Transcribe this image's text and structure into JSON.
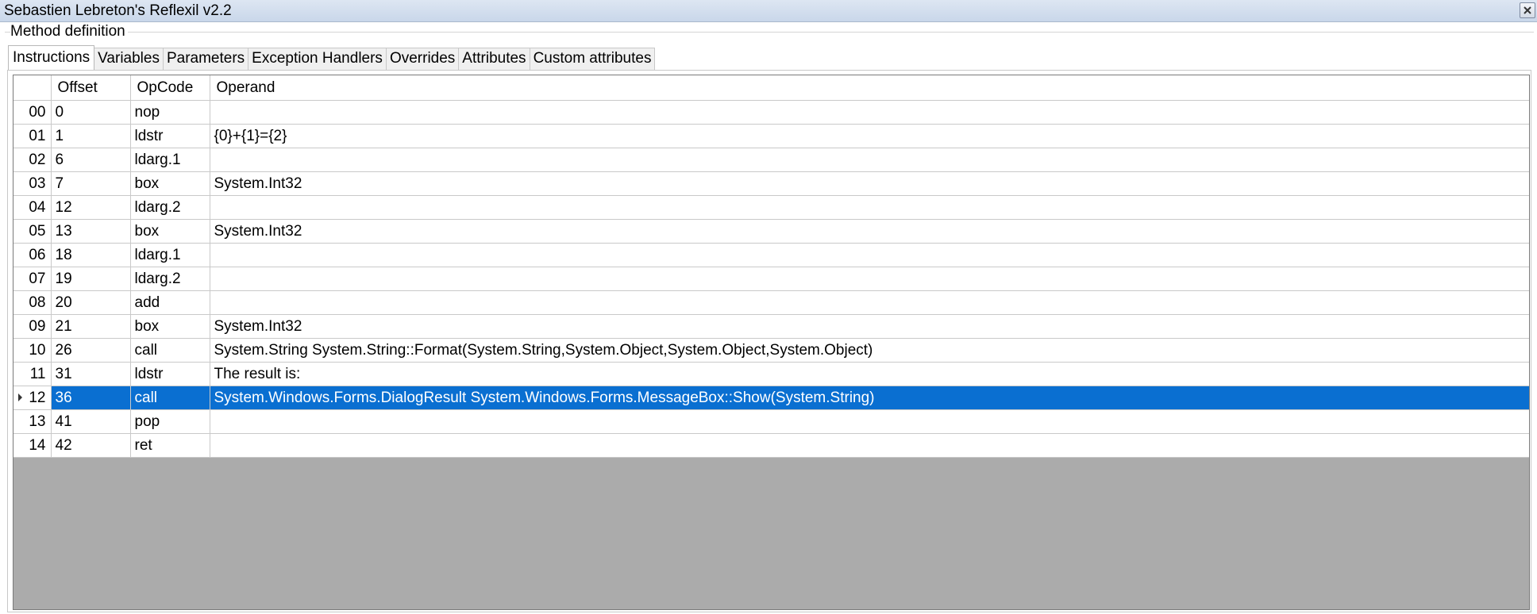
{
  "window": {
    "title": "Sebastien Lebreton's Reflexil v2.2"
  },
  "group": {
    "label": "Method definition"
  },
  "tabs": [
    {
      "label": "Instructions",
      "active": true
    },
    {
      "label": "Variables",
      "active": false
    },
    {
      "label": "Parameters",
      "active": false
    },
    {
      "label": "Exception Handlers",
      "active": false
    },
    {
      "label": "Overrides",
      "active": false
    },
    {
      "label": "Attributes",
      "active": false
    },
    {
      "label": "Custom attributes",
      "active": false
    }
  ],
  "grid": {
    "columns": [
      "Offset",
      "OpCode",
      "Operand"
    ],
    "selected_index": 12,
    "rows": [
      {
        "index": "00",
        "offset": "0",
        "opcode": "nop",
        "operand": ""
      },
      {
        "index": "01",
        "offset": "1",
        "opcode": "ldstr",
        "operand": "{0}+{1}={2}"
      },
      {
        "index": "02",
        "offset": "6",
        "opcode": "ldarg.1",
        "operand": ""
      },
      {
        "index": "03",
        "offset": "7",
        "opcode": "box",
        "operand": "System.Int32"
      },
      {
        "index": "04",
        "offset": "12",
        "opcode": "ldarg.2",
        "operand": ""
      },
      {
        "index": "05",
        "offset": "13",
        "opcode": "box",
        "operand": "System.Int32"
      },
      {
        "index": "06",
        "offset": "18",
        "opcode": "ldarg.1",
        "operand": ""
      },
      {
        "index": "07",
        "offset": "19",
        "opcode": "ldarg.2",
        "operand": ""
      },
      {
        "index": "08",
        "offset": "20",
        "opcode": "add",
        "operand": ""
      },
      {
        "index": "09",
        "offset": "21",
        "opcode": "box",
        "operand": "System.Int32"
      },
      {
        "index": "10",
        "offset": "26",
        "opcode": "call",
        "operand": "System.String System.String::Format(System.String,System.Object,System.Object,System.Object)"
      },
      {
        "index": "11",
        "offset": "31",
        "opcode": "ldstr",
        "operand": "The result is:"
      },
      {
        "index": "12",
        "offset": "36",
        "opcode": "call",
        "operand": "System.Windows.Forms.DialogResult System.Windows.Forms.MessageBox::Show(System.String)"
      },
      {
        "index": "13",
        "offset": "41",
        "opcode": "pop",
        "operand": ""
      },
      {
        "index": "14",
        "offset": "42",
        "opcode": "ret",
        "operand": ""
      }
    ]
  },
  "colors": {
    "selection": "#0a6fd1",
    "grid_background": "#ababab"
  }
}
